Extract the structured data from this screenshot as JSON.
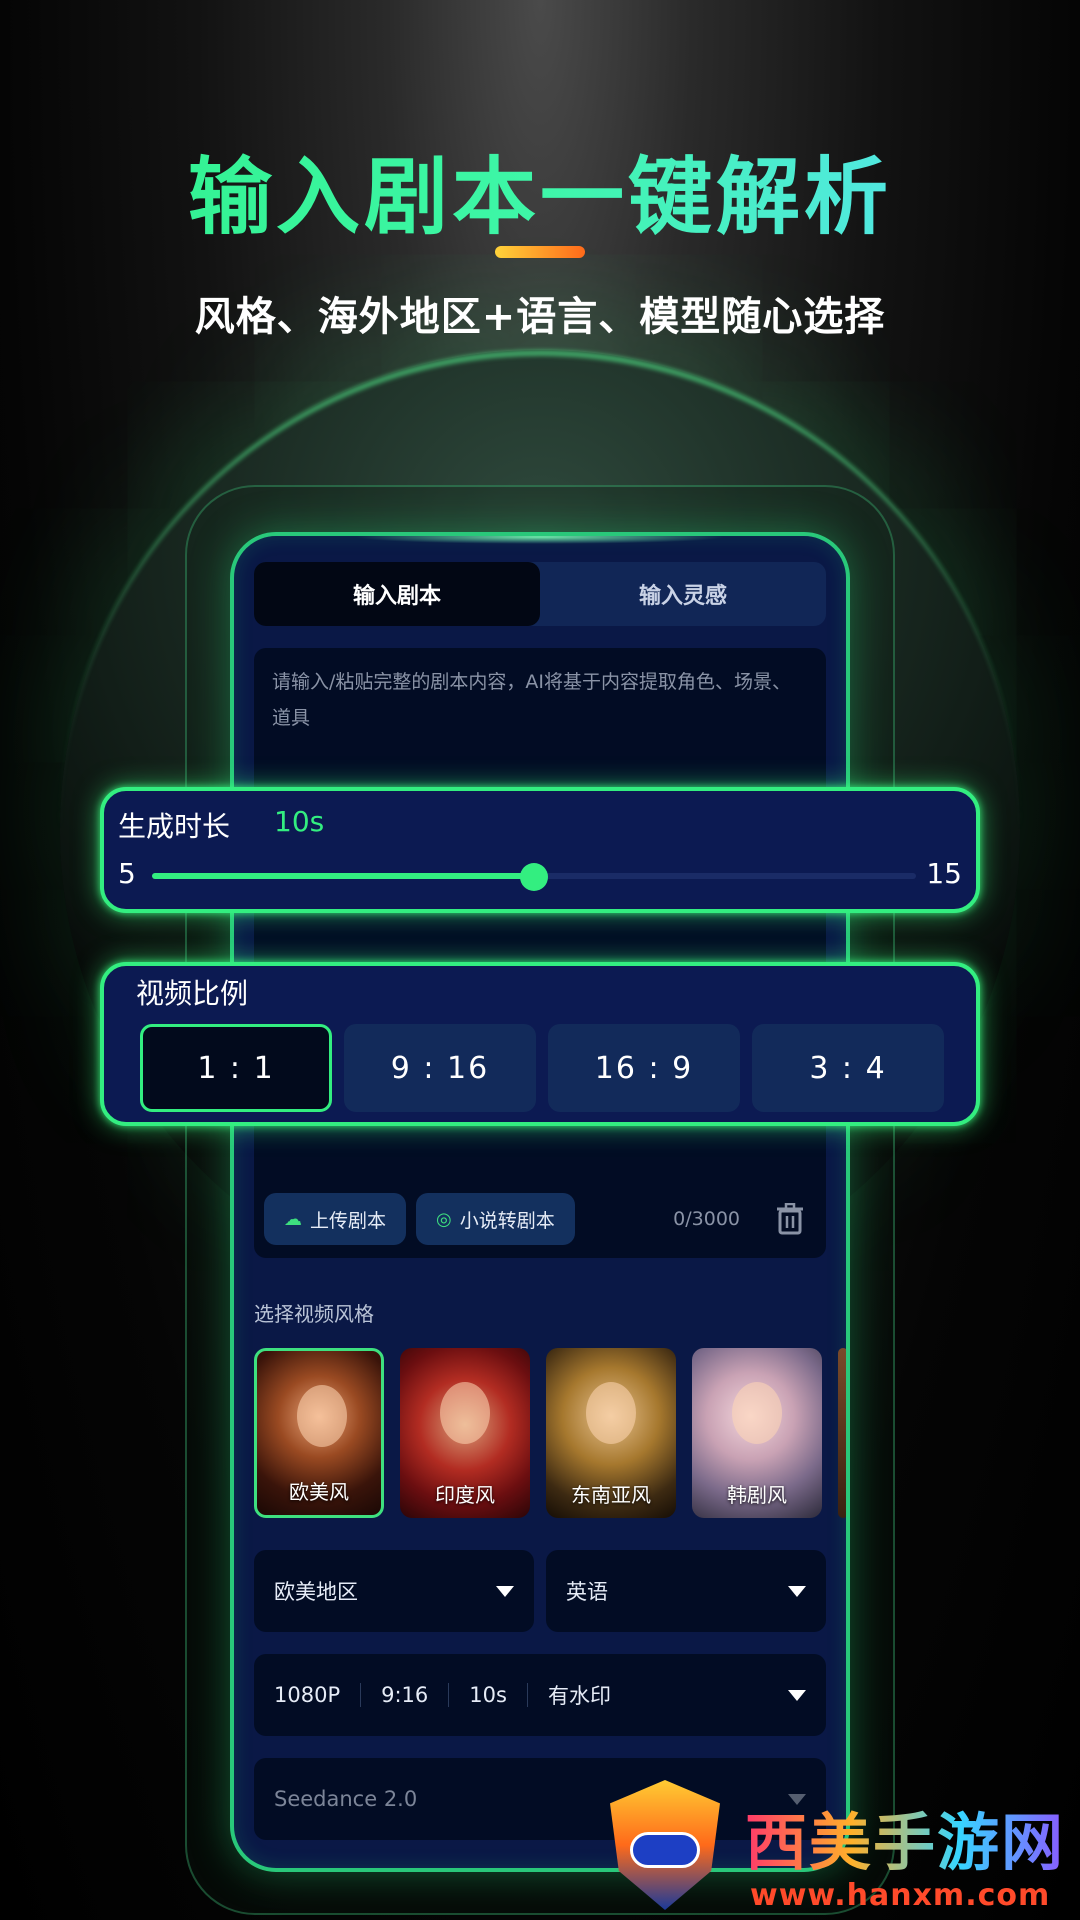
{
  "hero": {
    "title": "输入剧本一键解析",
    "subtitle": "风格、海外地区+语言、模型随心选择"
  },
  "tabs": [
    {
      "label": "输入剧本",
      "active": true
    },
    {
      "label": "输入灵感",
      "active": false
    }
  ],
  "editor": {
    "placeholder": "请输入/粘贴完整的剧本内容，AI将基于内容提取角色、场景、道具",
    "upload_label": "上传剧本",
    "novel_label": "小说转剧本",
    "char_count": "0/3000"
  },
  "duration": {
    "label": "生成时长",
    "value_text": "10s",
    "min": "5",
    "max": "15",
    "value": 10
  },
  "aspect": {
    "label": "视频比例",
    "options": [
      "1 : 1",
      "9 : 16",
      "16 : 9",
      "3 : 4"
    ],
    "selected": "1 : 1"
  },
  "styles": {
    "label": "选择视频风格",
    "items": [
      {
        "name": "欧美风",
        "selected": true
      },
      {
        "name": "印度风",
        "selected": false
      },
      {
        "name": "东南亚风",
        "selected": false
      },
      {
        "name": "韩剧风",
        "selected": false
      }
    ]
  },
  "region": {
    "value": "欧美地区"
  },
  "language": {
    "value": "英语"
  },
  "params": {
    "resolution": "1080P",
    "ratio": "9:16",
    "duration": "10s",
    "watermark": "有水印"
  },
  "model": {
    "value": "Seedance 2.0"
  },
  "watermark": {
    "name": "西美手游网",
    "url": "www.hanxm.com"
  },
  "colors": {
    "accent": "#33EE80",
    "panel": "#0A1846",
    "field": "#020C24"
  }
}
